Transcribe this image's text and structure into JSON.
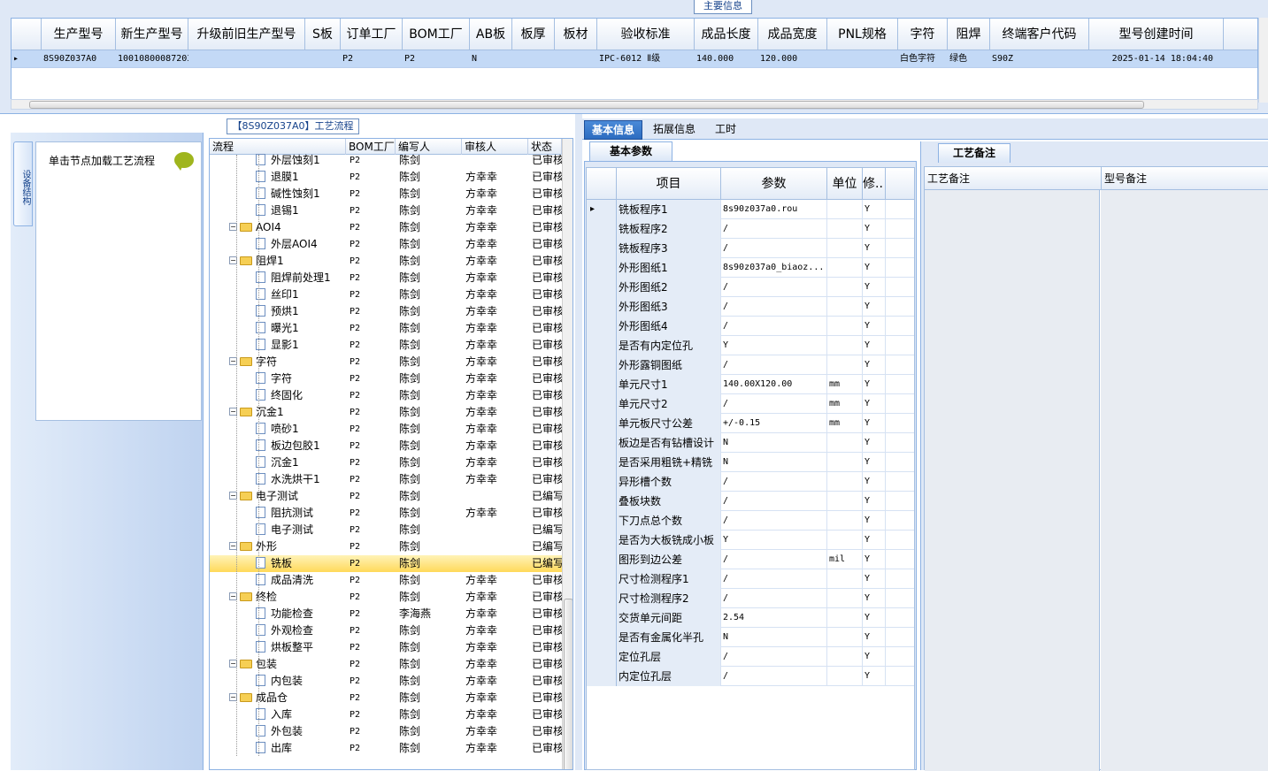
{
  "top": {
    "label": "主要信息",
    "columns": [
      "生产型号",
      "新生产型号",
      "升级前旧生产型号",
      "S板",
      "订单工厂",
      "BOM工厂",
      "AB板",
      "板厚",
      "板材",
      "验收标准",
      "成品长度",
      "成品宽度",
      "PNL规格",
      "字符",
      "阻焊",
      "终端客户代码",
      "型号创建时间"
    ],
    "row": [
      "8S90Z037A0",
      "10010800087203",
      "",
      "",
      "P2",
      "P2",
      "N",
      "",
      "",
      "IPC-6012 Ⅱ级",
      "140.000",
      "120.000",
      "",
      "白色字符",
      "绿色",
      "S90Z",
      "2025-01-14 18:04:40"
    ]
  },
  "left": {
    "tab_label": "设备结构",
    "hint": "单击节点加载工艺流程"
  },
  "process": {
    "title": "【8S90Z037A0】工艺流程",
    "columns": [
      "流程",
      "BOM工厂",
      "编写人",
      "审核人",
      "状态"
    ],
    "rows": [
      {
        "level": 1,
        "name": "外层蚀刻1",
        "bom": "P2",
        "writer": "陈剑",
        "reviewer": "",
        "status": "已审核"
      },
      {
        "level": 1,
        "name": "退膜1",
        "bom": "P2",
        "writer": "陈剑",
        "reviewer": "方幸幸",
        "status": "已审核"
      },
      {
        "level": 1,
        "name": "碱性蚀刻1",
        "bom": "P2",
        "writer": "陈剑",
        "reviewer": "方幸幸",
        "status": "已审核"
      },
      {
        "level": 1,
        "name": "退锡1",
        "bom": "P2",
        "writer": "陈剑",
        "reviewer": "方幸幸",
        "status": "已审核"
      },
      {
        "level": 0,
        "name": "AOI4",
        "bom": "P2",
        "writer": "陈剑",
        "reviewer": "方幸幸",
        "status": "已审核"
      },
      {
        "level": 1,
        "name": "外层AOI4",
        "bom": "P2",
        "writer": "陈剑",
        "reviewer": "方幸幸",
        "status": "已审核"
      },
      {
        "level": 0,
        "name": "阻焊1",
        "bom": "P2",
        "writer": "陈剑",
        "reviewer": "方幸幸",
        "status": "已审核"
      },
      {
        "level": 1,
        "name": "阻焊前处理1",
        "bom": "P2",
        "writer": "陈剑",
        "reviewer": "方幸幸",
        "status": "已审核"
      },
      {
        "level": 1,
        "name": "丝印1",
        "bom": "P2",
        "writer": "陈剑",
        "reviewer": "方幸幸",
        "status": "已审核"
      },
      {
        "level": 1,
        "name": "预烘1",
        "bom": "P2",
        "writer": "陈剑",
        "reviewer": "方幸幸",
        "status": "已审核"
      },
      {
        "level": 1,
        "name": "曝光1",
        "bom": "P2",
        "writer": "陈剑",
        "reviewer": "方幸幸",
        "status": "已审核"
      },
      {
        "level": 1,
        "name": "显影1",
        "bom": "P2",
        "writer": "陈剑",
        "reviewer": "方幸幸",
        "status": "已审核"
      },
      {
        "level": 0,
        "name": "字符",
        "bom": "P2",
        "writer": "陈剑",
        "reviewer": "方幸幸",
        "status": "已审核"
      },
      {
        "level": 1,
        "name": "字符",
        "bom": "P2",
        "writer": "陈剑",
        "reviewer": "方幸幸",
        "status": "已审核"
      },
      {
        "level": 1,
        "name": "终固化",
        "bom": "P2",
        "writer": "陈剑",
        "reviewer": "方幸幸",
        "status": "已审核"
      },
      {
        "level": 0,
        "name": "沉金1",
        "bom": "P2",
        "writer": "陈剑",
        "reviewer": "方幸幸",
        "status": "已审核"
      },
      {
        "level": 1,
        "name": "喷砂1",
        "bom": "P2",
        "writer": "陈剑",
        "reviewer": "方幸幸",
        "status": "已审核"
      },
      {
        "level": 1,
        "name": "板边包胶1",
        "bom": "P2",
        "writer": "陈剑",
        "reviewer": "方幸幸",
        "status": "已审核"
      },
      {
        "level": 1,
        "name": "沉金1",
        "bom": "P2",
        "writer": "陈剑",
        "reviewer": "方幸幸",
        "status": "已审核"
      },
      {
        "level": 1,
        "name": "水洗烘干1",
        "bom": "P2",
        "writer": "陈剑",
        "reviewer": "方幸幸",
        "status": "已审核"
      },
      {
        "level": 0,
        "name": "电子测试",
        "bom": "P2",
        "writer": "陈剑",
        "reviewer": "",
        "status": "已编写"
      },
      {
        "level": 1,
        "name": "阻抗测试",
        "bom": "P2",
        "writer": "陈剑",
        "reviewer": "方幸幸",
        "status": "已审核"
      },
      {
        "level": 1,
        "name": "电子测试",
        "bom": "P2",
        "writer": "陈剑",
        "reviewer": "",
        "status": "已编写"
      },
      {
        "level": 0,
        "name": "外形",
        "bom": "P2",
        "writer": "陈剑",
        "reviewer": "",
        "status": "已编写"
      },
      {
        "level": 1,
        "name": "铣板",
        "bom": "P2",
        "writer": "陈剑",
        "reviewer": "",
        "status": "已编写",
        "selected": true
      },
      {
        "level": 1,
        "name": "成品清洗",
        "bom": "P2",
        "writer": "陈剑",
        "reviewer": "方幸幸",
        "status": "已审核"
      },
      {
        "level": 0,
        "name": "终检",
        "bom": "P2",
        "writer": "陈剑",
        "reviewer": "方幸幸",
        "status": "已审核"
      },
      {
        "level": 1,
        "name": "功能检查",
        "bom": "P2",
        "writer": "李海燕",
        "reviewer": "方幸幸",
        "status": "已审核"
      },
      {
        "level": 1,
        "name": "外观检查",
        "bom": "P2",
        "writer": "陈剑",
        "reviewer": "方幸幸",
        "status": "已审核"
      },
      {
        "level": 1,
        "name": "烘板整平",
        "bom": "P2",
        "writer": "陈剑",
        "reviewer": "方幸幸",
        "status": "已审核"
      },
      {
        "level": 0,
        "name": "包装",
        "bom": "P2",
        "writer": "陈剑",
        "reviewer": "方幸幸",
        "status": "已审核"
      },
      {
        "level": 1,
        "name": "内包装",
        "bom": "P2",
        "writer": "陈剑",
        "reviewer": "方幸幸",
        "status": "已审核"
      },
      {
        "level": 0,
        "name": "成品仓",
        "bom": "P2",
        "writer": "陈剑",
        "reviewer": "方幸幸",
        "status": "已审核"
      },
      {
        "level": 1,
        "name": "入库",
        "bom": "P2",
        "writer": "陈剑",
        "reviewer": "方幸幸",
        "status": "已审核"
      },
      {
        "level": 1,
        "name": "外包装",
        "bom": "P2",
        "writer": "陈剑",
        "reviewer": "方幸幸",
        "status": "已审核"
      },
      {
        "level": 1,
        "name": "出库",
        "bom": "P2",
        "writer": "陈剑",
        "reviewer": "方幸幸",
        "status": "已审核"
      }
    ]
  },
  "tabs": [
    "基本信息",
    "拓展信息",
    "工时"
  ],
  "params": {
    "subtab": "基本参数",
    "columns": [
      "项目",
      "参数",
      "单位",
      "修.."
    ],
    "rows": [
      [
        "铣板程序1",
        "8s90z037a0.rou",
        "",
        "Y"
      ],
      [
        "铣板程序2",
        "/",
        "",
        "Y"
      ],
      [
        "铣板程序3",
        "/",
        "",
        "Y"
      ],
      [
        "外形图纸1",
        "8s90z037a0_biaoz...",
        "",
        "Y"
      ],
      [
        "外形图纸2",
        "/",
        "",
        "Y"
      ],
      [
        "外形图纸3",
        "/",
        "",
        "Y"
      ],
      [
        "外形图纸4",
        "/",
        "",
        "Y"
      ],
      [
        "是否有内定位孔",
        "Y",
        "",
        "Y"
      ],
      [
        "外形露铜图纸",
        "/",
        "",
        "Y"
      ],
      [
        "单元尺寸1",
        "140.00X120.00",
        "mm",
        "Y"
      ],
      [
        "单元尺寸2",
        "/",
        "mm",
        "Y"
      ],
      [
        "单元板尺寸公差",
        "+/-0.15",
        "mm",
        "Y"
      ],
      [
        "板边是否有钻槽设计",
        "N",
        "",
        "Y"
      ],
      [
        "是否采用粗铣+精铣",
        "N",
        "",
        "Y"
      ],
      [
        "异形槽个数",
        "/",
        "",
        "Y"
      ],
      [
        "叠板块数",
        "/",
        "",
        "Y"
      ],
      [
        "下刀点总个数",
        "/",
        "",
        "Y"
      ],
      [
        "是否为大板铣成小板",
        "Y",
        "",
        "Y"
      ],
      [
        "图形到边公差",
        "/",
        "mil",
        "Y"
      ],
      [
        "尺寸检测程序1",
        "/",
        "",
        "Y"
      ],
      [
        "尺寸检测程序2",
        "/",
        "",
        "Y"
      ],
      [
        "交货单元间距",
        "2.54",
        "",
        "Y"
      ],
      [
        "是否有金属化半孔",
        "N",
        "",
        "Y"
      ],
      [
        "定位孔层",
        "/",
        "",
        "Y"
      ],
      [
        "内定位孔层",
        "/",
        "",
        "Y"
      ]
    ]
  },
  "remark": {
    "tab": "工艺备注",
    "col1": "工艺备注",
    "col2": "型号备注"
  }
}
